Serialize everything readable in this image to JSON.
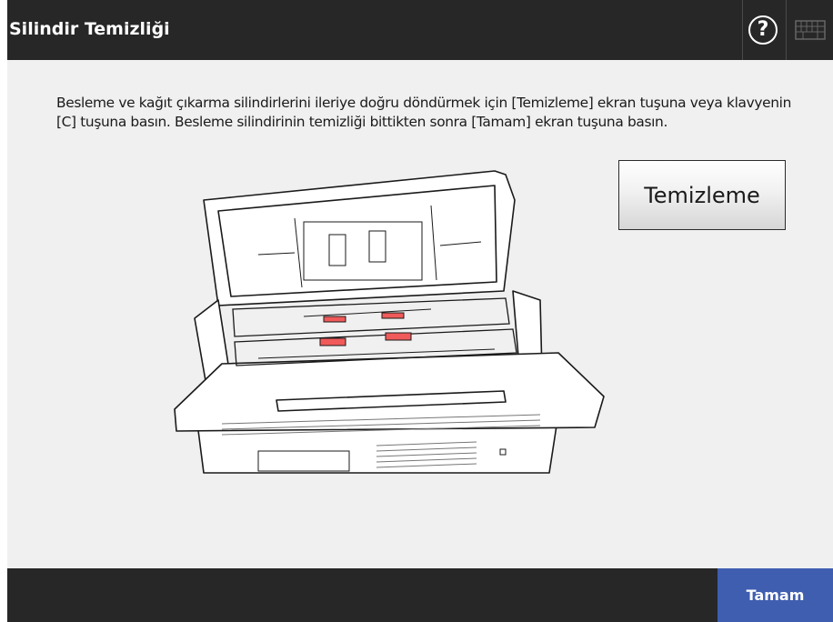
{
  "header": {
    "title": "Silindir Temizliği",
    "help_label": "?",
    "help_icon": "help-icon",
    "keyboard_icon": "keyboard-icon"
  },
  "main": {
    "instruction": "Besleme ve kağıt çıkarma silindirlerini ileriye doğru döndürmek için [Temizleme] ekran tuşuna veya klavyenin [C] tuşuna basın. Besleme silindirinin temizliği bittikten sonra [Tamam] ekran tuşuna basın.",
    "clean_button_label": "Temizleme",
    "illustration": "scanner-open-rollers-illustration"
  },
  "footer": {
    "ok_button_label": "Tamam"
  },
  "colors": {
    "header_bg": "#272727",
    "body_bg": "#f0f0f0",
    "ok_button_bg": "#3f5eb0",
    "roller_highlight": "#f05a5a"
  }
}
